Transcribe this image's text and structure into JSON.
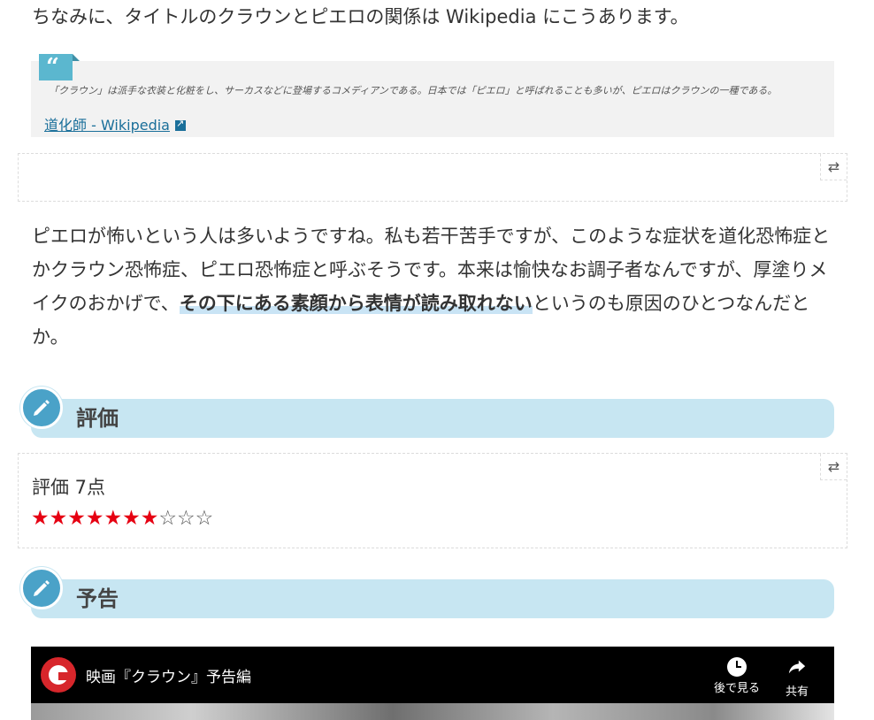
{
  "intro_text": "ちなみに、タイトルのクラウンとピエロの関係は Wikipedia にこうあります。",
  "quote": {
    "text": "「クラウン」は派手な衣装と化粧をし、サーカスなどに登場するコメディアンである。日本では「ピエロ」と呼ばれることも多いが、ピエロはクラウンの一種である。",
    "link": "道化師 - Wikipedia"
  },
  "paragraph": {
    "before": "ピエロが怖いという人は多いようですね。私も若干苦手ですが、このような症状を道化恐怖症とかクラウン恐怖症、ピエロ恐怖症と呼ぶそうです。本来は愉快なお調子者なんですが、厚塗りメイクのおかげで、",
    "highlight": "その下にある素顔から表情が読み取れない",
    "after": "というのも原因のひとつなんだとか。"
  },
  "headings": {
    "rating": "評価",
    "trailer": "予告"
  },
  "rating": {
    "label": "評価 7点",
    "score": 7,
    "max": 10,
    "filled_color": "#e60012"
  },
  "video": {
    "title": "映画『クラウン』予告編",
    "watch_later": "後で見る",
    "share": "共有"
  },
  "colors": {
    "heading_bg": "#c7e6f2",
    "pencil_circle": "#4aa2c8",
    "link": "#1a6f9a"
  }
}
